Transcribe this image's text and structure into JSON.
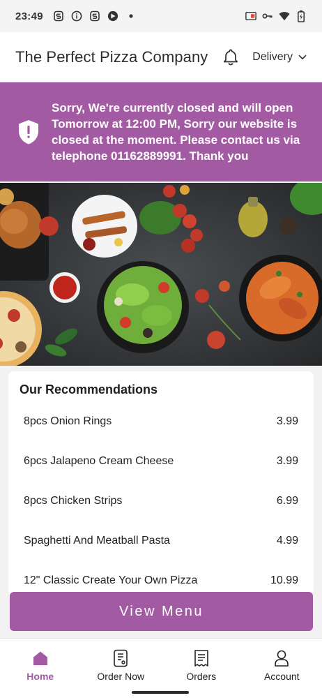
{
  "status_bar": {
    "time": "23:49"
  },
  "header": {
    "title": "The Perfect Pizza Company",
    "delivery_label": "Delivery"
  },
  "banner": {
    "message": "Sorry, We're currently closed and will open Tomorrow at 12:00 PM, Sorry our website is closed at the moment. Please contact us via telephone 01162889991. Thank you"
  },
  "recommendations": {
    "title": "Our Recommendations",
    "items": [
      {
        "name": "8pcs Onion Rings",
        "price": "3.99"
      },
      {
        "name": "6pcs Jalapeno Cream Cheese",
        "price": "3.99"
      },
      {
        "name": "8pcs Chicken Strips",
        "price": "6.99"
      },
      {
        "name": "Spaghetti And Meatball Pasta",
        "price": "4.99"
      },
      {
        "name": "12\" Classic Create Your Own Pizza",
        "price": "10.99"
      }
    ]
  },
  "view_menu_label": "View Menu",
  "nav": {
    "home": "Home",
    "order_now": "Order Now",
    "orders": "Orders",
    "account": "Account"
  },
  "colors": {
    "accent": "#a25ba3",
    "header_bg": "#ffffff",
    "banner_text": "#ffffff"
  }
}
